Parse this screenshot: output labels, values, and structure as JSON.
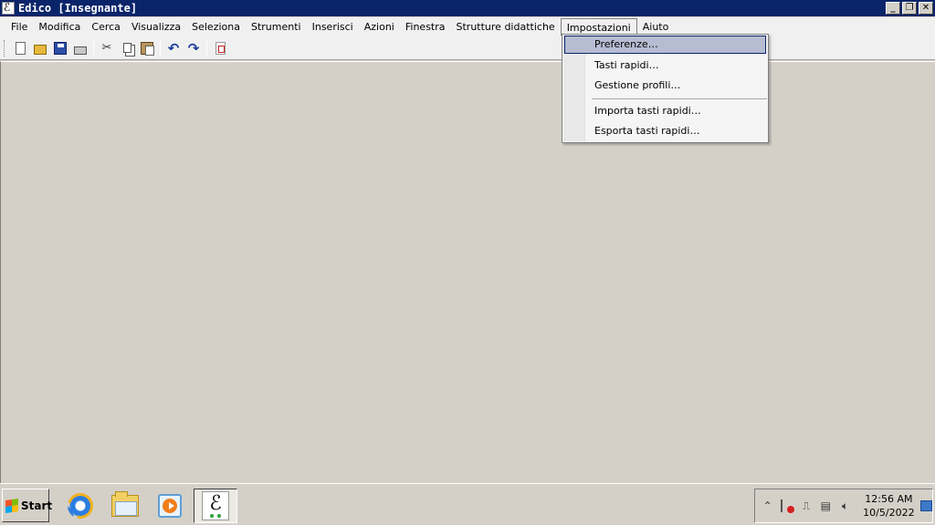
{
  "window": {
    "title": "Edico [Insegnante]",
    "buttons": {
      "minimize": "_",
      "restore": "❐",
      "close": "✕"
    }
  },
  "menubar": {
    "items": [
      {
        "label": "File"
      },
      {
        "label": "Modifica"
      },
      {
        "label": "Cerca"
      },
      {
        "label": "Visualizza"
      },
      {
        "label": "Seleziona"
      },
      {
        "label": "Strumenti"
      },
      {
        "label": "Inserisci"
      },
      {
        "label": "Azioni"
      },
      {
        "label": "Finestra"
      },
      {
        "label": "Strutture didattiche"
      },
      {
        "label": "Impostazioni"
      },
      {
        "label": "Aiuto"
      }
    ],
    "open_menu": "Impostazioni"
  },
  "toolbar": {
    "icons": [
      "new-icon",
      "open-icon",
      "save-icon",
      "print-icon",
      "cut-icon",
      "copy-icon",
      "paste-icon",
      "undo-icon",
      "redo-icon",
      "pdf-icon"
    ],
    "cut_glyph": "✂",
    "undo_glyph": "↶",
    "redo_glyph": "↷"
  },
  "dropdown": {
    "items": [
      {
        "label": "Preferenze…",
        "highlighted": true
      },
      {
        "label": "Tasti rapidi…"
      },
      {
        "label": "Gestione profili…"
      },
      {
        "label": "Importa tasti rapidi…"
      },
      {
        "label": "Esporta tasti rapidi…"
      }
    ],
    "highlight_color": "#b6bdd2"
  },
  "taskbar": {
    "start_label": "Start",
    "pinned": [
      "internet-explorer-icon",
      "windows-explorer-icon",
      "media-player-icon"
    ],
    "active_app": "edico-icon",
    "edico_glyph": "ℰ",
    "tray": {
      "chevron": "⌃",
      "time": "12:56 AM",
      "date": "10/5/2022"
    }
  },
  "colors": {
    "titlebar": "#0a246a",
    "workspace": "#d4d0c8",
    "menubar": "#f0f0f0"
  }
}
